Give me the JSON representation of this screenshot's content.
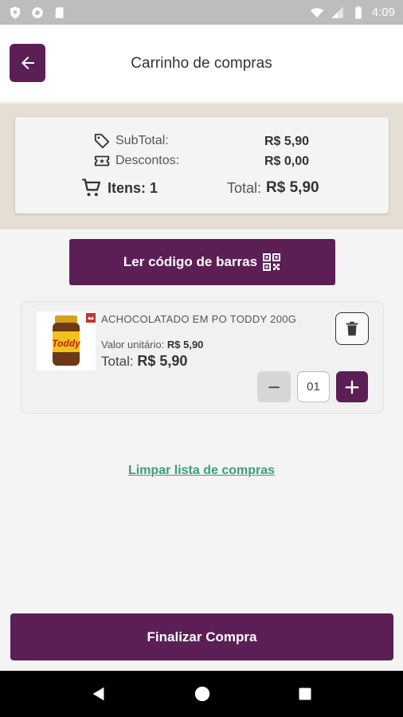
{
  "status_bar": {
    "time": "4:09"
  },
  "app_bar": {
    "title": "Carrinho de compras"
  },
  "summary": {
    "subtotal_label": "SubTotal:",
    "subtotal_value": "R$ 5,90",
    "discount_label": "Descontos:",
    "discount_value": "R$ 0,00",
    "items_label": "Itens: 1",
    "total_label": "Total:",
    "total_value": "R$ 5,90"
  },
  "scan_button": {
    "label": "Ler código de barras"
  },
  "cart_items": [
    {
      "name": "ACHOCOLATADO EM PO TODDY 200G",
      "unit_label": "Valor unitário:",
      "unit_price": "R$ 5,90",
      "total_label": "Total:",
      "total_price": "R$ 5,90",
      "quantity": "01",
      "image_text": "Toddy"
    }
  ],
  "clear_link": {
    "label": "Limpar lista de compras"
  },
  "finalize_button": {
    "label": "Finalizar Compra"
  },
  "colors": {
    "primary": "#5b1f56",
    "link": "#3d9d7c",
    "summary_bg": "#e5ded2"
  }
}
